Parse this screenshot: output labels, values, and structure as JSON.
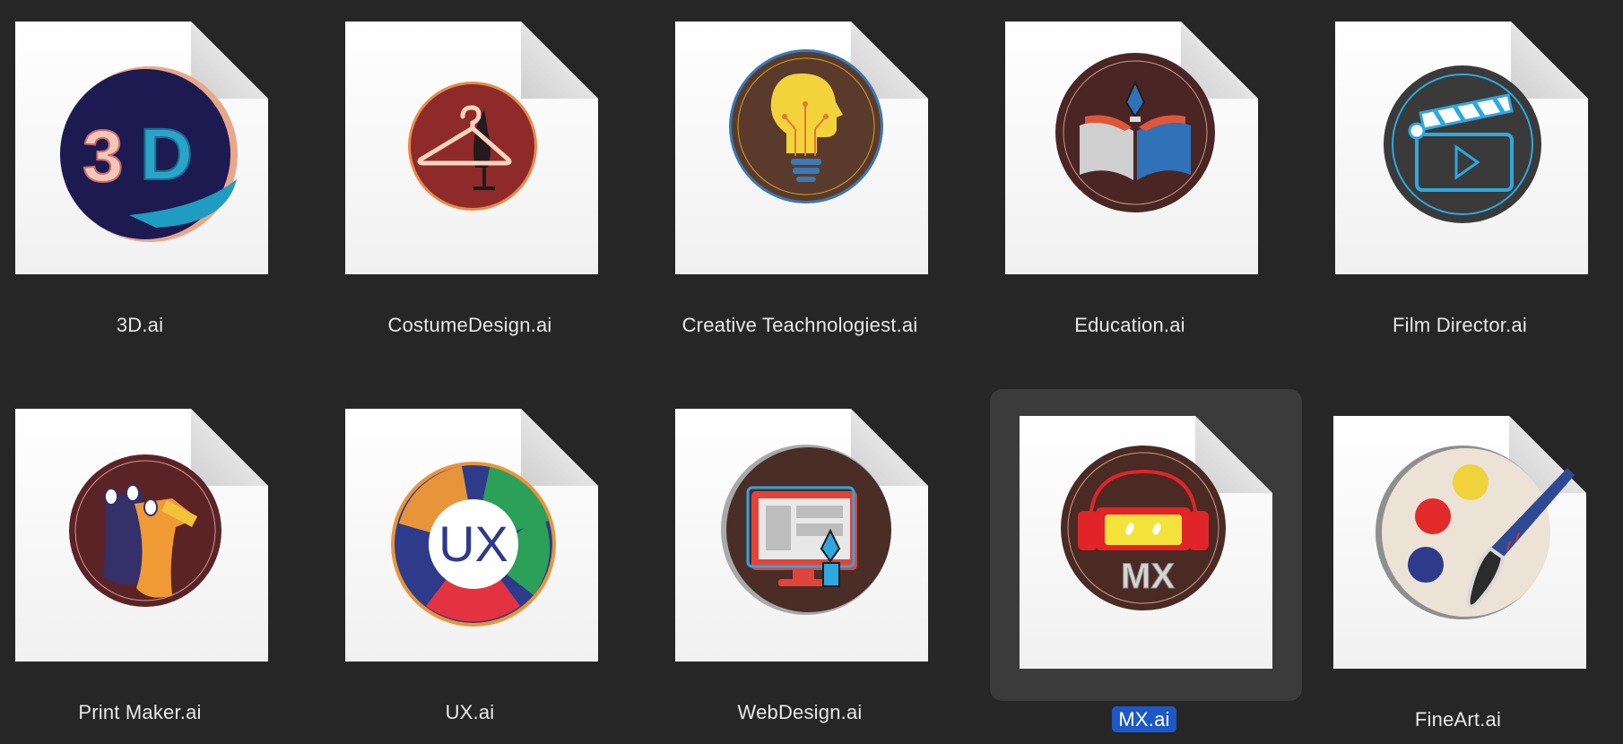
{
  "files": [
    {
      "name": "3D.ai",
      "icon": "3d-logo-icon"
    },
    {
      "name": "CostumeDesign.ai",
      "icon": "hanger-mannequin-icon"
    },
    {
      "name": "Creative Teachnologiest.ai",
      "icon": "lightbulb-head-icon"
    },
    {
      "name": "Education.ai",
      "icon": "book-pen-icon"
    },
    {
      "name": "Film Director.ai",
      "icon": "clapperboard-icon"
    },
    {
      "name": "Print Maker.ai",
      "icon": "ink-rollers-icon"
    },
    {
      "name": "UX.ai",
      "icon": "ux-circle-icon"
    },
    {
      "name": "WebDesign.ai",
      "icon": "monitor-pen-icon"
    },
    {
      "name": "MX.ai",
      "icon": "headphones-mx-icon",
      "selected": true
    },
    {
      "name": "FineArt.ai",
      "icon": "palette-brush-icon"
    }
  ],
  "colors": {
    "background": "#262626",
    "selection_tile": "#3b3b3b",
    "selection_label": "#1d58c7"
  }
}
